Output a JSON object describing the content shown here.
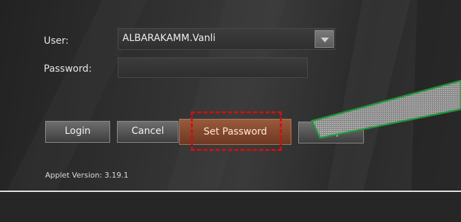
{
  "form": {
    "user_label": "User:",
    "user_value": "ALBARAKAMM.Vanli",
    "password_label": "Password:",
    "password_value": ""
  },
  "buttons": {
    "login": "Login",
    "cancel": "Cancel",
    "set_password": "Set Password",
    "help": "Help"
  },
  "footer": {
    "applet_version": "Applet Version: 3.19.1"
  },
  "icons": [
    "chevron-down-icon"
  ],
  "colors": {
    "highlight_red": "#cc1111",
    "annotation_green": "#1f9a3a",
    "accent_button": "#7e4229"
  }
}
